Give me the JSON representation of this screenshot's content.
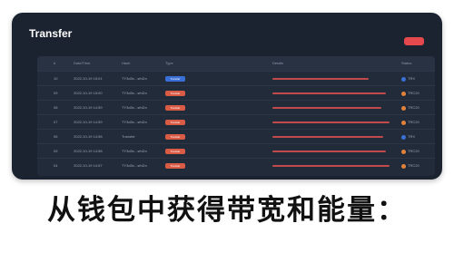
{
  "window": {
    "title": "Transfer",
    "action_button_label": ""
  },
  "table": {
    "headers": [
      "#",
      "Date/Time",
      "Hash",
      "Type",
      "",
      "Details",
      "Status"
    ],
    "rows": [
      {
        "index": "10",
        "date": "2022-10-19 15:01",
        "hash": "TY3cBx...sfnDn",
        "type_badge": "Transfer",
        "status": "TRX",
        "badge_color": "blue",
        "bar_fraction": 0.78,
        "dot_color": "blue"
      },
      {
        "index": "09",
        "date": "2022-10-19 15:00",
        "hash": "TY3cBx...sfnDn",
        "type_badge": "Transfer",
        "status": "TRC20",
        "badge_color": "red",
        "bar_fraction": 0.92,
        "dot_color": "orange"
      },
      {
        "index": "08",
        "date": "2022-10-19 14:59",
        "hash": "TY3cBx...sfnDn",
        "type_badge": "Transfer",
        "status": "TRC20",
        "badge_color": "red",
        "bar_fraction": 0.88,
        "dot_color": "orange"
      },
      {
        "index": "07",
        "date": "2022-10-19 14:59",
        "hash": "TY3cBx...sfnDn",
        "type_badge": "Transfer",
        "status": "TRC20",
        "badge_color": "red",
        "bar_fraction": 0.95,
        "dot_color": "orange"
      },
      {
        "index": "06",
        "date": "2022-10-19 14:58",
        "hash": "Transfer",
        "type_badge": "Transfer",
        "status": "TRX",
        "badge_color": "red",
        "bar_fraction": 0.9,
        "dot_color": "blue"
      },
      {
        "index": "05",
        "date": "2022-10-19 14:58",
        "hash": "TY3cBx...sfnDn",
        "type_badge": "Transfer",
        "status": "TRC20",
        "badge_color": "red",
        "bar_fraction": 0.92,
        "dot_color": "orange"
      },
      {
        "index": "04",
        "date": "2022-10-19 14:57",
        "hash": "TY3cBx...sfnDn",
        "type_badge": "Transfer",
        "status": "TRC20",
        "badge_color": "red",
        "bar_fraction": 0.95,
        "dot_color": "orange"
      }
    ]
  },
  "banner_text": "从钱包中获得带宽和能量：",
  "colors": {
    "window_bg": "#1b2330",
    "accent_red": "#e5484d",
    "accent_blue": "#3b6fd8",
    "accent_orange": "#e0823c"
  }
}
